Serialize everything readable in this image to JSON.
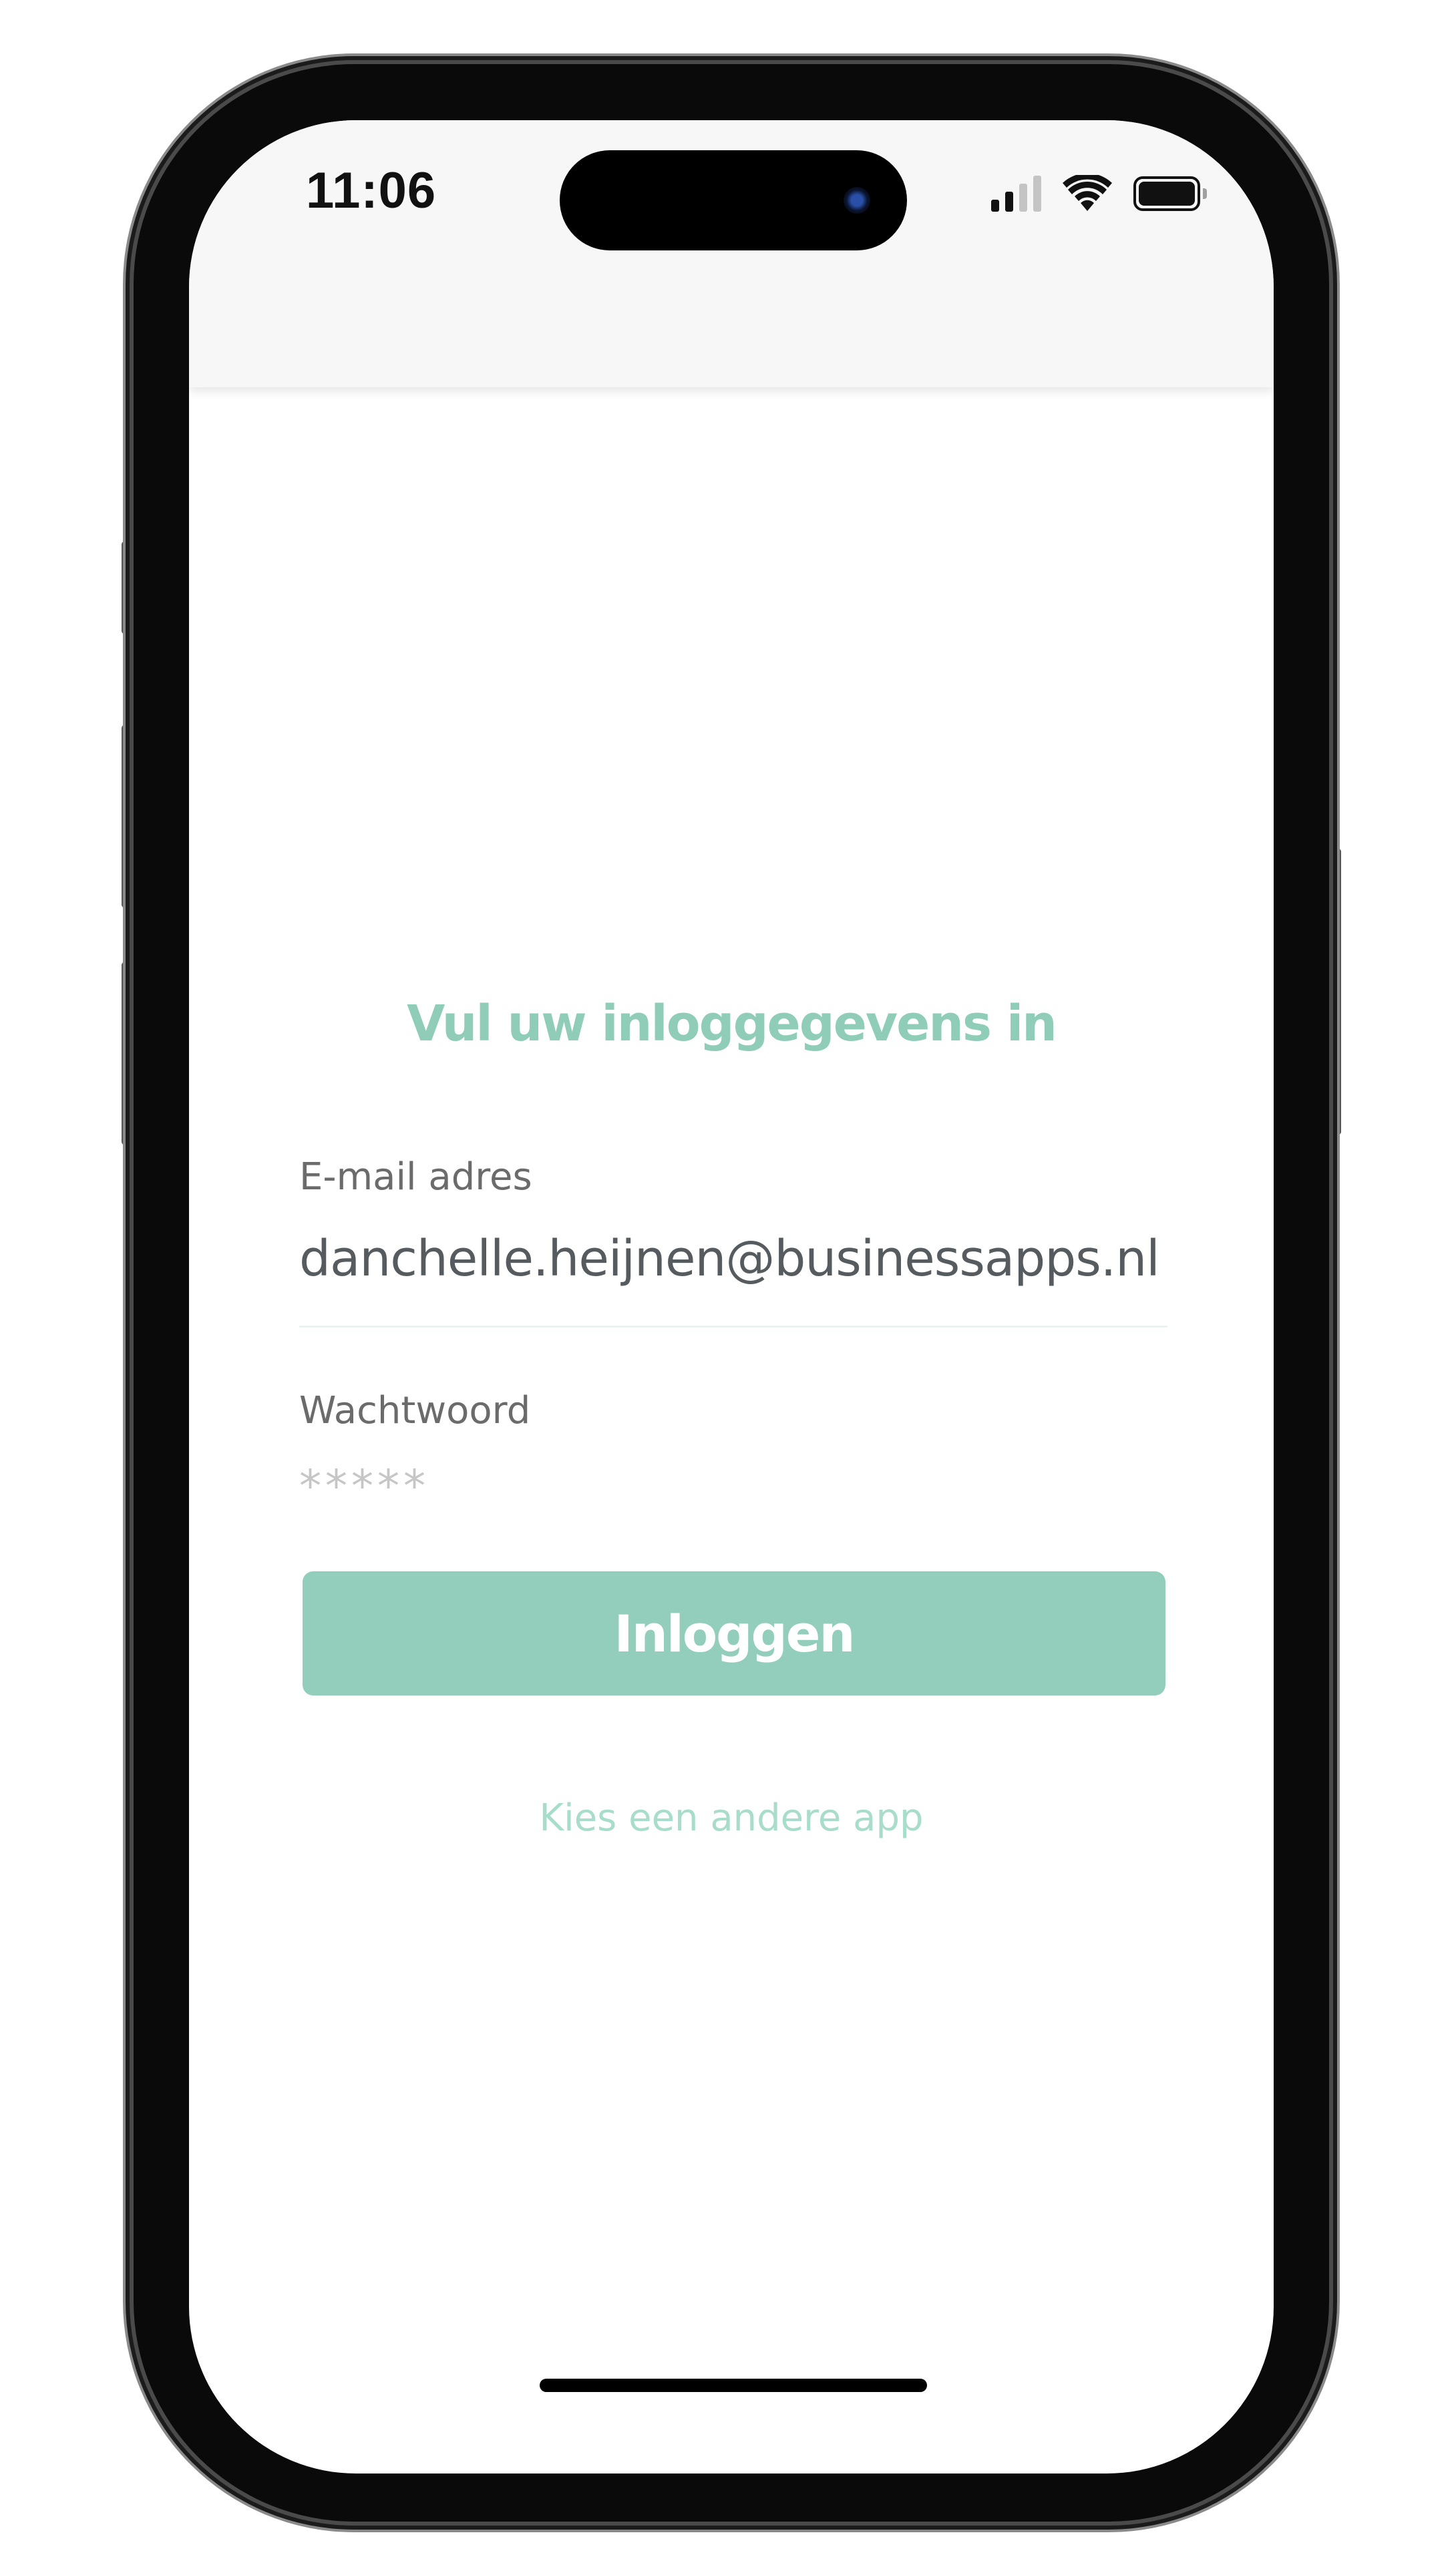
{
  "status_bar": {
    "time": "11:06"
  },
  "login": {
    "title": "Vul uw inloggegevens in",
    "email_label": "E-mail adres",
    "email_value": "danchelle.heijnen@businessapps.nl",
    "password_label": "Wachtwoord",
    "password_placeholder": "*****",
    "submit_label": "Inloggen",
    "other_app_link": "Kies een andere app"
  },
  "colors": {
    "accent": "#93cdbb",
    "title": "#8fcdb9",
    "link": "#a8dccb",
    "label": "#6b6b6b",
    "input_text": "#555b5f"
  },
  "icons": [
    "signal-icon",
    "wifi-icon",
    "battery-icon"
  ]
}
